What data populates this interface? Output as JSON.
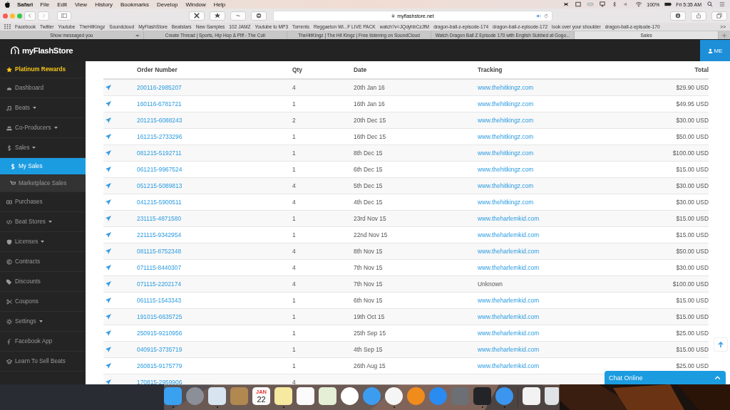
{
  "menubar": {
    "app": "Safari",
    "menus": [
      "File",
      "Edit",
      "View",
      "History",
      "Bookmarks",
      "Develop",
      "Window",
      "Help"
    ],
    "battery": "100%",
    "clock": "Fri 5:35 AM"
  },
  "toolbar": {
    "address": "myflashstore.net"
  },
  "bookmarks": {
    "items": [
      "Facebook",
      "Twitter",
      "Youtube",
      "TheHitKingz",
      "Soundcloud",
      "MyFlashStore",
      "Beatstars",
      "New Samples",
      "102 JAMZ",
      "Youtube to MP3",
      "Torrents",
      "Reggaeton Wi...F LIVE PACK",
      "watch?v=JQdyhbCzJfM",
      "dragon-ball-z-episode-174",
      "dragon-ball-z-episode-172",
      "look over your shoulder",
      "dragon-ball-z-episode-170"
    ],
    "more": ">>"
  },
  "tabs": [
    {
      "title": "Show messaged you",
      "selected": false,
      "audio": true
    },
    {
      "title": "Create Thread | Sports, Hip Hop & Piff - The Coli",
      "selected": false,
      "audio": false
    },
    {
      "title": "TheHitKingz | The Hit Kingz | Free listening on SoundCloud",
      "selected": false,
      "audio": false
    },
    {
      "title": "Watch Dragon Ball Z Episode 170 with English Subbed at Gogo...",
      "selected": false,
      "audio": false
    },
    {
      "title": "Sales",
      "selected": true,
      "audio": false
    }
  ],
  "header": {
    "logo": "myFlashStore",
    "user": "ME"
  },
  "sidebar": {
    "items": [
      {
        "label": "Platinum Rewards",
        "kind": "rewards",
        "dropdown": false,
        "selected": false
      },
      {
        "label": "Dashboard",
        "kind": "link",
        "dropdown": false,
        "selected": false
      },
      {
        "label": "Beats",
        "kind": "link",
        "dropdown": true,
        "selected": false
      },
      {
        "label": "Co-Producers",
        "kind": "link",
        "dropdown": true,
        "selected": false
      },
      {
        "label": "Sales",
        "kind": "link",
        "dropdown": true,
        "selected": false,
        "children": [
          {
            "label": "My Sales",
            "selected": true
          },
          {
            "label": "Marketplace Sales",
            "selected": false
          }
        ]
      },
      {
        "label": "Purchases",
        "kind": "link",
        "dropdown": false,
        "selected": false
      },
      {
        "label": "Beat Stores",
        "kind": "link",
        "dropdown": true,
        "selected": false
      },
      {
        "label": "Licenses",
        "kind": "link",
        "dropdown": true,
        "selected": false
      },
      {
        "label": "Contracts",
        "kind": "link",
        "dropdown": false,
        "selected": false
      },
      {
        "label": "Discounts",
        "kind": "link",
        "dropdown": false,
        "selected": false
      },
      {
        "label": "Coupons",
        "kind": "link",
        "dropdown": false,
        "selected": false
      },
      {
        "label": "Settings",
        "kind": "link",
        "dropdown": true,
        "selected": false
      },
      {
        "label": "Facebook App",
        "kind": "link",
        "dropdown": false,
        "selected": false
      },
      {
        "label": "Learn To Sell Beats",
        "kind": "link",
        "dropdown": false,
        "selected": false
      }
    ]
  },
  "table": {
    "columns": [
      "Order Number",
      "Qty",
      "Date",
      "Tracking",
      "Total"
    ],
    "rows": [
      {
        "order": "200116-2985207",
        "qty": "4",
        "date": "20th Jan 16",
        "tracking": "www.thehitkingz.com",
        "tracking_link": true,
        "total": "$29.90 USD"
      },
      {
        "order": "160116-6781721",
        "qty": "1",
        "date": "16th Jan 16",
        "tracking": "www.thehitkingz.com",
        "tracking_link": true,
        "total": "$49.95 USD"
      },
      {
        "order": "201215-6088243",
        "qty": "2",
        "date": "20th Dec 15",
        "tracking": "www.thehitkingz.com",
        "tracking_link": true,
        "total": "$30.00 USD"
      },
      {
        "order": "161215-2733296",
        "qty": "1",
        "date": "16th Dec 15",
        "tracking": "www.thehitkingz.com",
        "tracking_link": true,
        "total": "$50.00 USD"
      },
      {
        "order": "081215-5192711",
        "qty": "1",
        "date": "8th Dec 15",
        "tracking": "www.thehitkingz.com",
        "tracking_link": true,
        "total": "$100.00 USD"
      },
      {
        "order": "061215-9967524",
        "qty": "1",
        "date": "6th Dec 15",
        "tracking": "www.thehitkingz.com",
        "tracking_link": true,
        "total": "$15.00 USD"
      },
      {
        "order": "051215-5089813",
        "qty": "4",
        "date": "5th Dec 15",
        "tracking": "www.thehitkingz.com",
        "tracking_link": true,
        "total": "$30.00 USD"
      },
      {
        "order": "041215-5900511",
        "qty": "4",
        "date": "4th Dec 15",
        "tracking": "www.thehitkingz.com",
        "tracking_link": true,
        "total": "$30.00 USD"
      },
      {
        "order": "231115-4871580",
        "qty": "1",
        "date": "23rd Nov 15",
        "tracking": "www.theharlemkid.com",
        "tracking_link": true,
        "total": "$15.00 USD"
      },
      {
        "order": "221115-9342954",
        "qty": "1",
        "date": "22nd Nov 15",
        "tracking": "www.theharlemkid.com",
        "tracking_link": true,
        "total": "$15.00 USD"
      },
      {
        "order": "081115-8752348",
        "qty": "4",
        "date": "8th Nov 15",
        "tracking": "www.theharlemkid.com",
        "tracking_link": true,
        "total": "$50.00 USD"
      },
      {
        "order": "071115-8440307",
        "qty": "4",
        "date": "7th Nov 15",
        "tracking": "www.theharlemkid.com",
        "tracking_link": true,
        "total": "$30.00 USD"
      },
      {
        "order": "071115-2202174",
        "qty": "4",
        "date": "7th Nov 15",
        "tracking": "Unknown",
        "tracking_link": false,
        "total": "$100.00 USD"
      },
      {
        "order": "061115-1543343",
        "qty": "1",
        "date": "6th Nov 15",
        "tracking": "www.theharlemkid.com",
        "tracking_link": true,
        "total": "$15.00 USD"
      },
      {
        "order": "191015-6635725",
        "qty": "1",
        "date": "19th Oct 15",
        "tracking": "www.theharlemkid.com",
        "tracking_link": true,
        "total": "$15.00 USD"
      },
      {
        "order": "250915-9210956",
        "qty": "1",
        "date": "25th Sep 15",
        "tracking": "www.theharlemkid.com",
        "tracking_link": true,
        "total": "$25.00 USD"
      },
      {
        "order": "040915-3735719",
        "qty": "1",
        "date": "4th Sep 15",
        "tracking": "www.theharlemkid.com",
        "tracking_link": true,
        "total": "$15.00 USD"
      },
      {
        "order": "260815-9175779",
        "qty": "1",
        "date": "26th Aug 15",
        "tracking": "www.theharlemkid.com",
        "tracking_link": true,
        "total": "$25.00 USD"
      },
      {
        "order": "170815-2959906",
        "qty": "4"
      }
    ]
  },
  "chat": {
    "label": "Chat Online"
  },
  "dock": {
    "apps": [
      {
        "running": true
      },
      {
        "running": false
      },
      {
        "running": true
      },
      {
        "running": false
      },
      {
        "running": false,
        "month": "JAN",
        "day": "22"
      },
      {
        "running": true
      },
      {
        "running": false
      },
      {
        "running": false
      },
      {
        "running": false
      },
      {
        "running": false
      },
      {
        "running": true
      },
      {
        "running": false
      },
      {
        "running": false
      },
      {
        "running": false
      },
      {
        "running": true
      },
      {
        "running": true
      },
      {
        "running": false
      },
      {
        "running": false
      }
    ]
  }
}
